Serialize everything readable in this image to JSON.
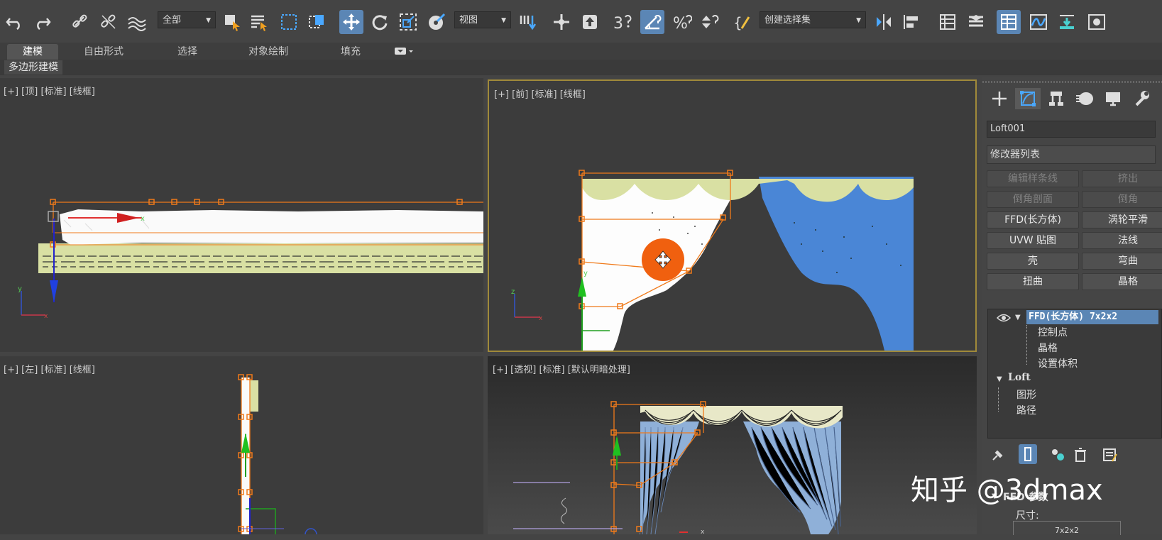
{
  "toolbar": {
    "selection_filter": "全部",
    "ref_coord": "视图",
    "named_selection": "创建选择集",
    "icons": [
      "undo-icon",
      "redo-icon",
      "link-icon",
      "unlink-icon",
      "bind-spacewarp-icon",
      "select-object-icon",
      "select-by-name-icon",
      "rect-region-icon",
      "window-crossing-icon",
      "move-icon",
      "rotate-icon",
      "scale-icon",
      "place-icon",
      "pivot-icon",
      "manipulate-icon",
      "snap-3d-icon",
      "angle-snap-icon",
      "percent-snap-icon",
      "spinner-snap-icon",
      "edit-named-sets-icon",
      "mirror-icon",
      "align-icon",
      "layer-explorer-icon",
      "layer-manager-icon",
      "scene-explorer-icon",
      "curve-editor-icon",
      "schematic-icon",
      "material-editor-icon"
    ]
  },
  "ribbon": {
    "tabs": [
      "建模",
      "自由形式",
      "选择",
      "对象绘制",
      "填充"
    ],
    "active_tab": "建模",
    "sub_label": "多边形建模"
  },
  "viewports": {
    "top": {
      "label": "[+] [顶] [标准] [线框]"
    },
    "front": {
      "label": "[+] [前] [标准] [线框]"
    },
    "left": {
      "label": "[+] [左] [标准] [线框]"
    },
    "perspective": {
      "label": "[+] [透视] [标准] [默认明暗处理]"
    }
  },
  "panel": {
    "object_name": "Loft001",
    "modifier_list": "修改器列表",
    "modifier_buttons": [
      {
        "label": "编辑样条线",
        "dim": true
      },
      {
        "label": "挤出",
        "dim": true
      },
      {
        "label": "倒角剖面",
        "dim": true
      },
      {
        "label": "倒角",
        "dim": true
      },
      {
        "label": "FFD(长方体)",
        "dim": false
      },
      {
        "label": "涡轮平滑",
        "dim": false
      },
      {
        "label": "UVW 贴图",
        "dim": false
      },
      {
        "label": "法线",
        "dim": false
      },
      {
        "label": "壳",
        "dim": false
      },
      {
        "label": "弯曲",
        "dim": false
      },
      {
        "label": "扭曲",
        "dim": false
      },
      {
        "label": "晶格",
        "dim": false
      }
    ],
    "stack": {
      "ffd_title": "FFD(长方体) 7x2x2",
      "ffd_children": [
        "控制点",
        "晶格",
        "设置体积"
      ],
      "loft_title": "Loft",
      "loft_children": [
        "图形",
        "路径"
      ]
    },
    "params_title": "FFD 参数",
    "size_label": "尺寸:",
    "size_value": "7x2x2"
  },
  "watermark": "知乎 @3dmax",
  "colors": {
    "accent_orange": "#f07a1a",
    "curtain_yellow": "#d9e0a3",
    "curtain_blue": "#4a86d6",
    "active_blue": "#5b86b5",
    "active_viewport_border": "#a08a3a"
  }
}
